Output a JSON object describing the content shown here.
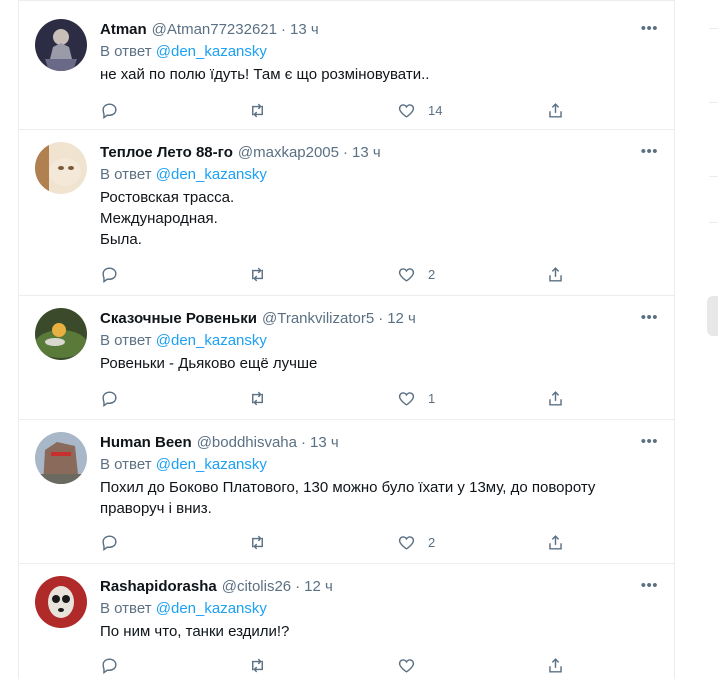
{
  "tweets": [
    {
      "name": "Atman",
      "handle": "@Atman77232621",
      "dot": "·",
      "time": "13 ч",
      "reply_prefix": "В ответ",
      "mention": "@den_kazansky",
      "text_lines": [
        "не хай по полю їдуть! Там є що розміновувати.."
      ],
      "likes": "14",
      "avatar_color": "#3a3a5a"
    },
    {
      "name": "Теплое Лето 88-го",
      "handle": "@maxkap2005",
      "dot": "·",
      "time": "13 ч",
      "reply_prefix": "В ответ",
      "mention": "@den_kazansky",
      "text_lines": [
        "Ростовская трасса.",
        "Международная.",
        "Была."
      ],
      "likes": "2",
      "avatar_color": "#e8c89a"
    },
    {
      "name": "Сказочные Ровеньки",
      "handle": "@Trankvilizator5",
      "dot": "·",
      "time": "12 ч",
      "reply_prefix": "В ответ",
      "mention": "@den_kazansky",
      "text_lines": [
        "Ровеньки - Дьяково ещё лучше"
      ],
      "likes": "1",
      "avatar_color": "#5a7a3a"
    },
    {
      "name": "Human Been",
      "handle": "@boddhisvaha",
      "dot": "·",
      "time": "13 ч",
      "reply_prefix": "В ответ",
      "mention": "@den_kazansky",
      "text_lines": [
        "Похил до Боково Платового, 130 можно було їхати у 13му, до повороту",
        "праворуч і вниз."
      ],
      "likes": "2",
      "avatar_color": "#8a7a70"
    },
    {
      "name": "Rashapidorasha",
      "handle": "@citolis26",
      "dot": "·",
      "time": "12 ч",
      "reply_prefix": "В ответ",
      "mention": "@den_kazansky",
      "text_lines": [
        "По ним что, танки ездили!?"
      ],
      "likes": "",
      "avatar_color": "#b02a2a"
    }
  ],
  "icons": {
    "more": "more-horizontal-icon",
    "reply": "reply-icon",
    "retweet": "retweet-icon",
    "like": "heart-icon",
    "share": "share-icon"
  },
  "colors": {
    "link": "#1da1f2",
    "secondary_text": "#5b7083",
    "primary_text": "#0f1419",
    "divider": "#ebeef0"
  }
}
